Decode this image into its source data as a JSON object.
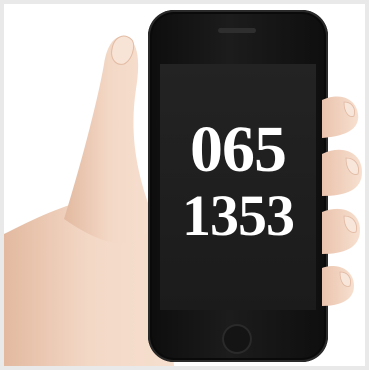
{
  "screen": {
    "line1": "065",
    "line2": "1353"
  },
  "colors": {
    "skin": "#f0d2be",
    "phone_body": "#141414",
    "screen_bg": "#1f1f1f",
    "text": "#ffffff"
  }
}
